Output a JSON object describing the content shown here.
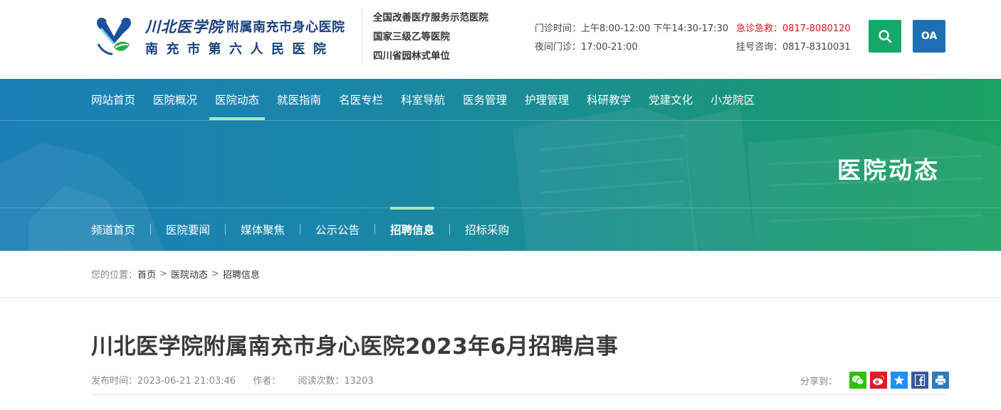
{
  "header": {
    "logo_script": "川北医学院",
    "logo_name1": "附属南充市身心医院",
    "logo_name2": "南充市第六人民医院",
    "honors": [
      "全国改善医疗服务示范医院",
      "国家三级乙等医院",
      "四川省园林式单位"
    ],
    "clinic_hours": "门诊时间：上午8:00-12:00 下午14:30-17:30",
    "night_clinic": "夜间门诊：17:00-21:00",
    "emergency": "急诊急救：0817-8080120",
    "registration": "挂号咨询：0817-8310031",
    "search_icon": "search-icon",
    "oa_label": "OA",
    "colors": {
      "brand": "#1a3f7f",
      "search_btn": "#16a86b",
      "oa_btn": "#1f6fb5",
      "emergency": "#d71818"
    }
  },
  "nav": {
    "items": [
      "网站首页",
      "医院概况",
      "医院动态",
      "就医指南",
      "名医专栏",
      "科室导航",
      "医务管理",
      "护理管理",
      "科研教学",
      "党建文化",
      "小龙院区"
    ],
    "active": "医院动态"
  },
  "banner": {
    "title": "医院动态",
    "colors": {
      "from": "#1b7fb6",
      "to": "#1ca063",
      "indicator": "#a7e8c4"
    }
  },
  "subnav": {
    "items": [
      "频道首页",
      "医院要闻",
      "媒体聚焦",
      "公示公告",
      "招聘信息",
      "招标采购"
    ],
    "active": "招聘信息"
  },
  "breadcrumb": {
    "prefix": "您的位置：",
    "items": [
      "首页",
      "医院动态",
      "招聘信息"
    ],
    "separator": ">"
  },
  "article": {
    "title": "川北医学院附属南充市身心医院2023年6月招聘启事",
    "publish_time": "发布时间：2023-06-21 21:03:46",
    "author": "作者：",
    "views": "阅读次数：13203",
    "share_label": "分享到：",
    "share_icons": [
      "wechat-icon",
      "weibo-icon",
      "qzone-icon",
      "facebook-icon",
      "print-icon"
    ],
    "share_colors": [
      "#2dc100",
      "#e6162d",
      "#1e90ff",
      "#3b5998",
      "#2f7bbf"
    ]
  }
}
